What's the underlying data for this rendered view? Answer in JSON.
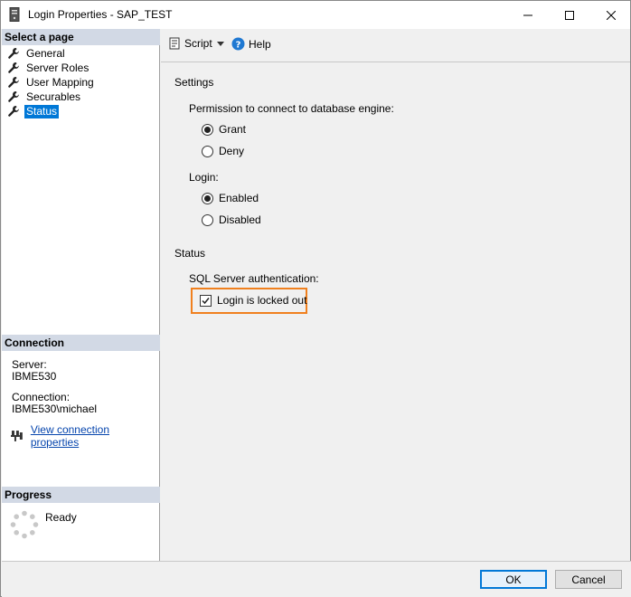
{
  "window": {
    "title": "Login Properties - SAP_TEST"
  },
  "left": {
    "select_header": "Select a page",
    "pages": [
      {
        "label": "General",
        "icon": "wrench-icon"
      },
      {
        "label": "Server Roles",
        "icon": "wrench-icon"
      },
      {
        "label": "User Mapping",
        "icon": "wrench-icon"
      },
      {
        "label": "Securables",
        "icon": "wrench-icon"
      },
      {
        "label": "Status",
        "icon": "wrench-icon",
        "selected": true
      }
    ],
    "connection_header": "Connection",
    "server_label": "Server:",
    "server_value": "IBME530",
    "connection_label": "Connection:",
    "connection_value": "IBME530\\michael",
    "view_link": "View connection properties",
    "progress_header": "Progress",
    "progress_status": "Ready"
  },
  "toolbar": {
    "script_label": "Script",
    "help_label": "Help"
  },
  "settings": {
    "heading": "Settings",
    "permission_label": "Permission to connect to database engine:",
    "grant": "Grant",
    "deny": "Deny",
    "permission_selected": "Grant",
    "login_label": "Login:",
    "enabled": "Enabled",
    "disabled": "Disabled",
    "login_selected": "Enabled"
  },
  "status": {
    "heading": "Status",
    "auth_label": "SQL Server authentication:",
    "locked_label": "Login is locked out",
    "locked_checked": true
  },
  "buttons": {
    "ok": "OK",
    "cancel": "Cancel"
  },
  "colors": {
    "selection": "#0078d7",
    "highlight_box": "#f0801e",
    "section_header": "#d2d9e5"
  }
}
